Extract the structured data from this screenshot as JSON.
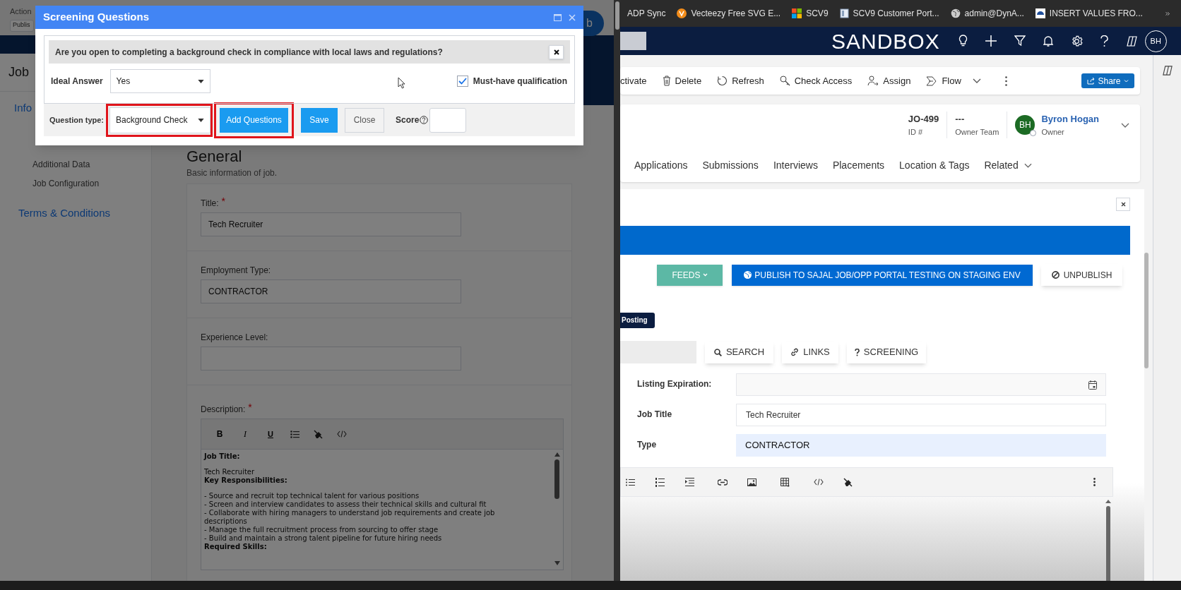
{
  "left_window": {
    "top_label": "Action",
    "select_value": "Publis",
    "corner_button": "b",
    "page_title": "Job",
    "sidebar_items": [
      {
        "label": "Info",
        "kind": "section"
      },
      {
        "label": "Additional Data",
        "kind": "sub"
      },
      {
        "label": "Job Configuration",
        "kind": "sub"
      },
      {
        "label": "Terms & Conditions",
        "kind": "section"
      }
    ],
    "section_title": "General",
    "section_subtitle": "Basic information of job.",
    "fields": [
      {
        "label": "Title:",
        "required_mark": "*",
        "value": "Tech Recruiter"
      },
      {
        "label": "Employment Type:",
        "value": "CONTRACTOR"
      },
      {
        "label": "Experience Level:"
      }
    ],
    "description": {
      "label": "Description:",
      "required_mark": "*",
      "toolbar": [
        {
          "kind": "bold",
          "label": "B"
        },
        {
          "kind": "italic",
          "label": "I"
        },
        {
          "kind": "underline",
          "label": "U"
        },
        {
          "kind": "list"
        },
        {
          "kind": "clear"
        },
        {
          "kind": "code"
        }
      ],
      "lines": [
        {
          "text": "Job Title:",
          "bold": true,
          "gap_after": true
        },
        {
          "text": "Tech Recruiter",
          "bold": false,
          "gap_after": false
        },
        {
          "text": "Key Responsibilities:",
          "bold": true,
          "gap_after": true
        },
        {
          "text": "- Source and recruit top technical talent for various positions",
          "bold": false,
          "gap_after": false
        },
        {
          "text": "- Screen and interview candidates to assess their technical skills and cultural fit",
          "bold": false,
          "gap_after": false
        },
        {
          "text": "- Collaborate with hiring managers to understand job requirements and create job descriptions",
          "bold": false,
          "gap_after": false
        },
        {
          "text": "- Manage the full recruitment process from sourcing to offer stage",
          "bold": false,
          "gap_after": false
        },
        {
          "text": "- Build and maintain a strong talent pipeline for future hiring needs",
          "bold": false,
          "gap_after": false
        },
        {
          "text": "Required Skills:",
          "bold": true,
          "gap_after": false
        }
      ]
    }
  },
  "dialog": {
    "title": "Screening Questions",
    "question": "Are you open to completing a background check in compliance with local laws and regulations?",
    "ideal_answer_label": "Ideal Answer",
    "ideal_answer": "Yes",
    "must_have_label": "Must-have qualification",
    "must_have": true,
    "question_type_label": "Question type:",
    "question_type": "Background Check",
    "question_type_highlighted": true,
    "buttons": [
      {
        "label": "Add Questions",
        "kind": "add",
        "highlighted": true
      },
      {
        "label": "Save",
        "kind": "primary",
        "highlighted": false
      },
      {
        "label": "Close",
        "kind": "secondary",
        "highlighted": false
      }
    ],
    "score_label": "Score"
  },
  "right_window": {
    "bookmarks": [
      {
        "label": "ADP Sync",
        "kind": "plain"
      },
      {
        "label": "Vecteezy Free SVG E...",
        "kind": "vecteezy"
      },
      {
        "label": "SCV9",
        "kind": "windows"
      },
      {
        "label": "SCV9 Customer Port...",
        "kind": "document"
      },
      {
        "label": "admin@DynA...",
        "kind": "globe"
      },
      {
        "label": "INSERT VALUES FRO...",
        "kind": "cloud"
      }
    ],
    "app_title": "SANDBOX",
    "user_initials": "BH",
    "commands": [
      {
        "label": "ctivate",
        "kind": "plain"
      },
      {
        "label": "Delete",
        "kind": "delete"
      },
      {
        "label": "Refresh",
        "kind": "refresh"
      },
      {
        "label": "Check Access",
        "kind": "key"
      },
      {
        "label": "Assign",
        "kind": "assign"
      },
      {
        "label": "Flow",
        "kind": "flow"
      }
    ],
    "share": "Share",
    "header_fields": [
      {
        "value": "JO-499",
        "label": "ID #"
      },
      {
        "value": "---",
        "label": "Owner Team"
      }
    ],
    "owner": {
      "initials": "BH",
      "name": "Byron Hogan",
      "label": "Owner"
    },
    "tabs": [
      {
        "label": "Applications"
      },
      {
        "label": "Submissions"
      },
      {
        "label": "Interviews"
      },
      {
        "label": "Placements"
      },
      {
        "label": "Location & Tags"
      },
      {
        "label": "Related",
        "kind": "dropdown"
      }
    ],
    "publish_buttons": [
      {
        "label": "FEEDS",
        "kind": "feeds"
      },
      {
        "label": "PUBLISH TO SAJAL JOB/OPP PORTAL TESTING ON STAGING ENV",
        "kind": "publish"
      },
      {
        "label": "UNPUBLISH",
        "kind": "unpublish"
      }
    ],
    "badge": "Posting",
    "tools": [
      {
        "label": "SEARCH",
        "kind": "search"
      },
      {
        "label": "LINKS",
        "kind": "links"
      },
      {
        "label": "SCREENING",
        "kind": "screening"
      }
    ],
    "form": [
      {
        "label": "Listing Expiration:",
        "kind": "date"
      },
      {
        "label": "Job Title",
        "kind": "text",
        "value": "Tech Recruiter"
      },
      {
        "label": "Type",
        "kind": "highlighted",
        "value": "CONTRACTOR"
      }
    ]
  }
}
